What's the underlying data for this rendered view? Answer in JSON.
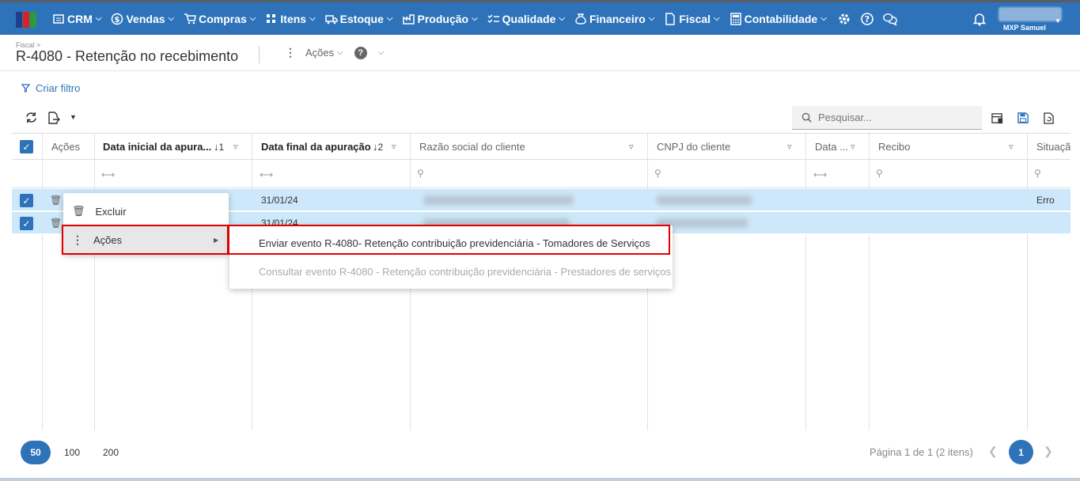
{
  "colors": {
    "primary": "#2e73ba",
    "topbar_border": "#565d65",
    "row_selected": "#cde8fb",
    "highlight_box": "#e00000"
  },
  "nav": {
    "items": [
      {
        "label": "CRM",
        "icon": "crm-icon"
      },
      {
        "label": "Vendas",
        "icon": "dollar-circle-icon"
      },
      {
        "label": "Compras",
        "icon": "cart-icon"
      },
      {
        "label": "Itens",
        "icon": "items-icon"
      },
      {
        "label": "Estoque",
        "icon": "truck-icon"
      },
      {
        "label": "Produção",
        "icon": "factory-icon"
      },
      {
        "label": "Qualidade",
        "icon": "checklist-icon"
      },
      {
        "label": "Financeiro",
        "icon": "money-bag-icon"
      },
      {
        "label": "Fiscal",
        "icon": "document-icon"
      },
      {
        "label": "Contabilidade",
        "icon": "calculator-icon"
      }
    ],
    "user_name": "MXP Samuel"
  },
  "header": {
    "breadcrumb": "Fiscal >",
    "title": "R-4080 - Retenção no recebimento",
    "actions_label": "Ações",
    "help_glyph": "?"
  },
  "toolbar": {
    "filter_label": "Criar filtro",
    "search_placeholder": "Pesquisar..."
  },
  "grid": {
    "columns": [
      {
        "label": "Ações"
      },
      {
        "label": "Data inicial da apura...",
        "sort": "1"
      },
      {
        "label": "Data final da apuração",
        "sort": "2"
      },
      {
        "label": "Razão social do cliente"
      },
      {
        "label": "CNPJ do cliente"
      },
      {
        "label": "Data ..."
      },
      {
        "label": "Recibo"
      },
      {
        "label": "Situaçã"
      }
    ],
    "rows": [
      {
        "data_final": "31/01/24",
        "situacao": "Erro"
      },
      {
        "data_final": "31/01/24",
        "situacao": ""
      }
    ]
  },
  "context_menu": {
    "items": [
      {
        "label": "Excluir",
        "icon": "trash-icon"
      },
      {
        "label": "Ações",
        "icon": "dots-vertical-icon"
      }
    ],
    "submenu": [
      {
        "label": "Enviar evento R-4080- Retenção contribuição previdenciária - Tomadores de Serviços",
        "enabled": true
      },
      {
        "label": "Consultar evento R-4080 - Retenção contribuição previdenciária - Prestadores de serviços",
        "enabled": false
      }
    ]
  },
  "pagination": {
    "sizes": [
      "50",
      "100",
      "200"
    ],
    "active_size": "50",
    "info": "Página 1 de 1 (2 itens)",
    "current_page": "1"
  }
}
